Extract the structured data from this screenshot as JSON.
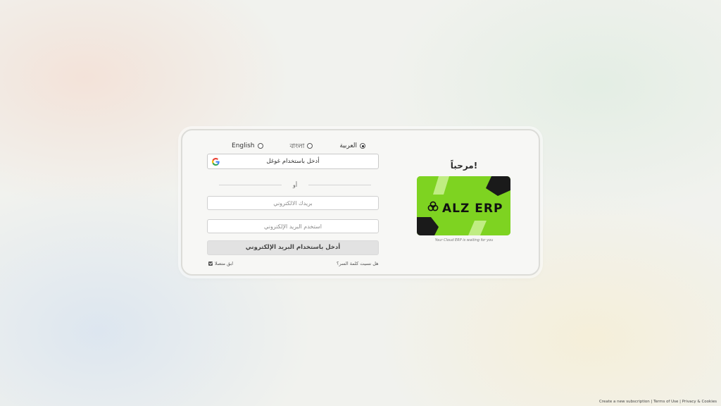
{
  "languages": [
    {
      "label": "العربية",
      "selected": true
    },
    {
      "label": "বাংলা",
      "selected": false
    },
    {
      "label": "English",
      "selected": false
    }
  ],
  "login": {
    "google_label": "أدخل باستخدام غوغل",
    "or_label": "أو",
    "email_placeholder": "بريدك الالكتروني",
    "password_placeholder": "استخدم البريد الإلكتروني",
    "submit_label": "أدخل باستخدام البريد الإلكتروني",
    "forgot_label": "هل نسيت كلمة السر؟",
    "stay_label": "ابق متصلا",
    "stay_checked": true
  },
  "brand": {
    "welcome": "مرحباً!",
    "logo_text": "ALZ ERP",
    "tagline": "Your Cloud ERP is waiting for you",
    "logo_color": "#7ed321"
  },
  "footer": {
    "create_label": "Create a new subscription",
    "terms_label": "Terms of Use",
    "privacy_label": "Privacy & Cookies",
    "separator": "|"
  }
}
